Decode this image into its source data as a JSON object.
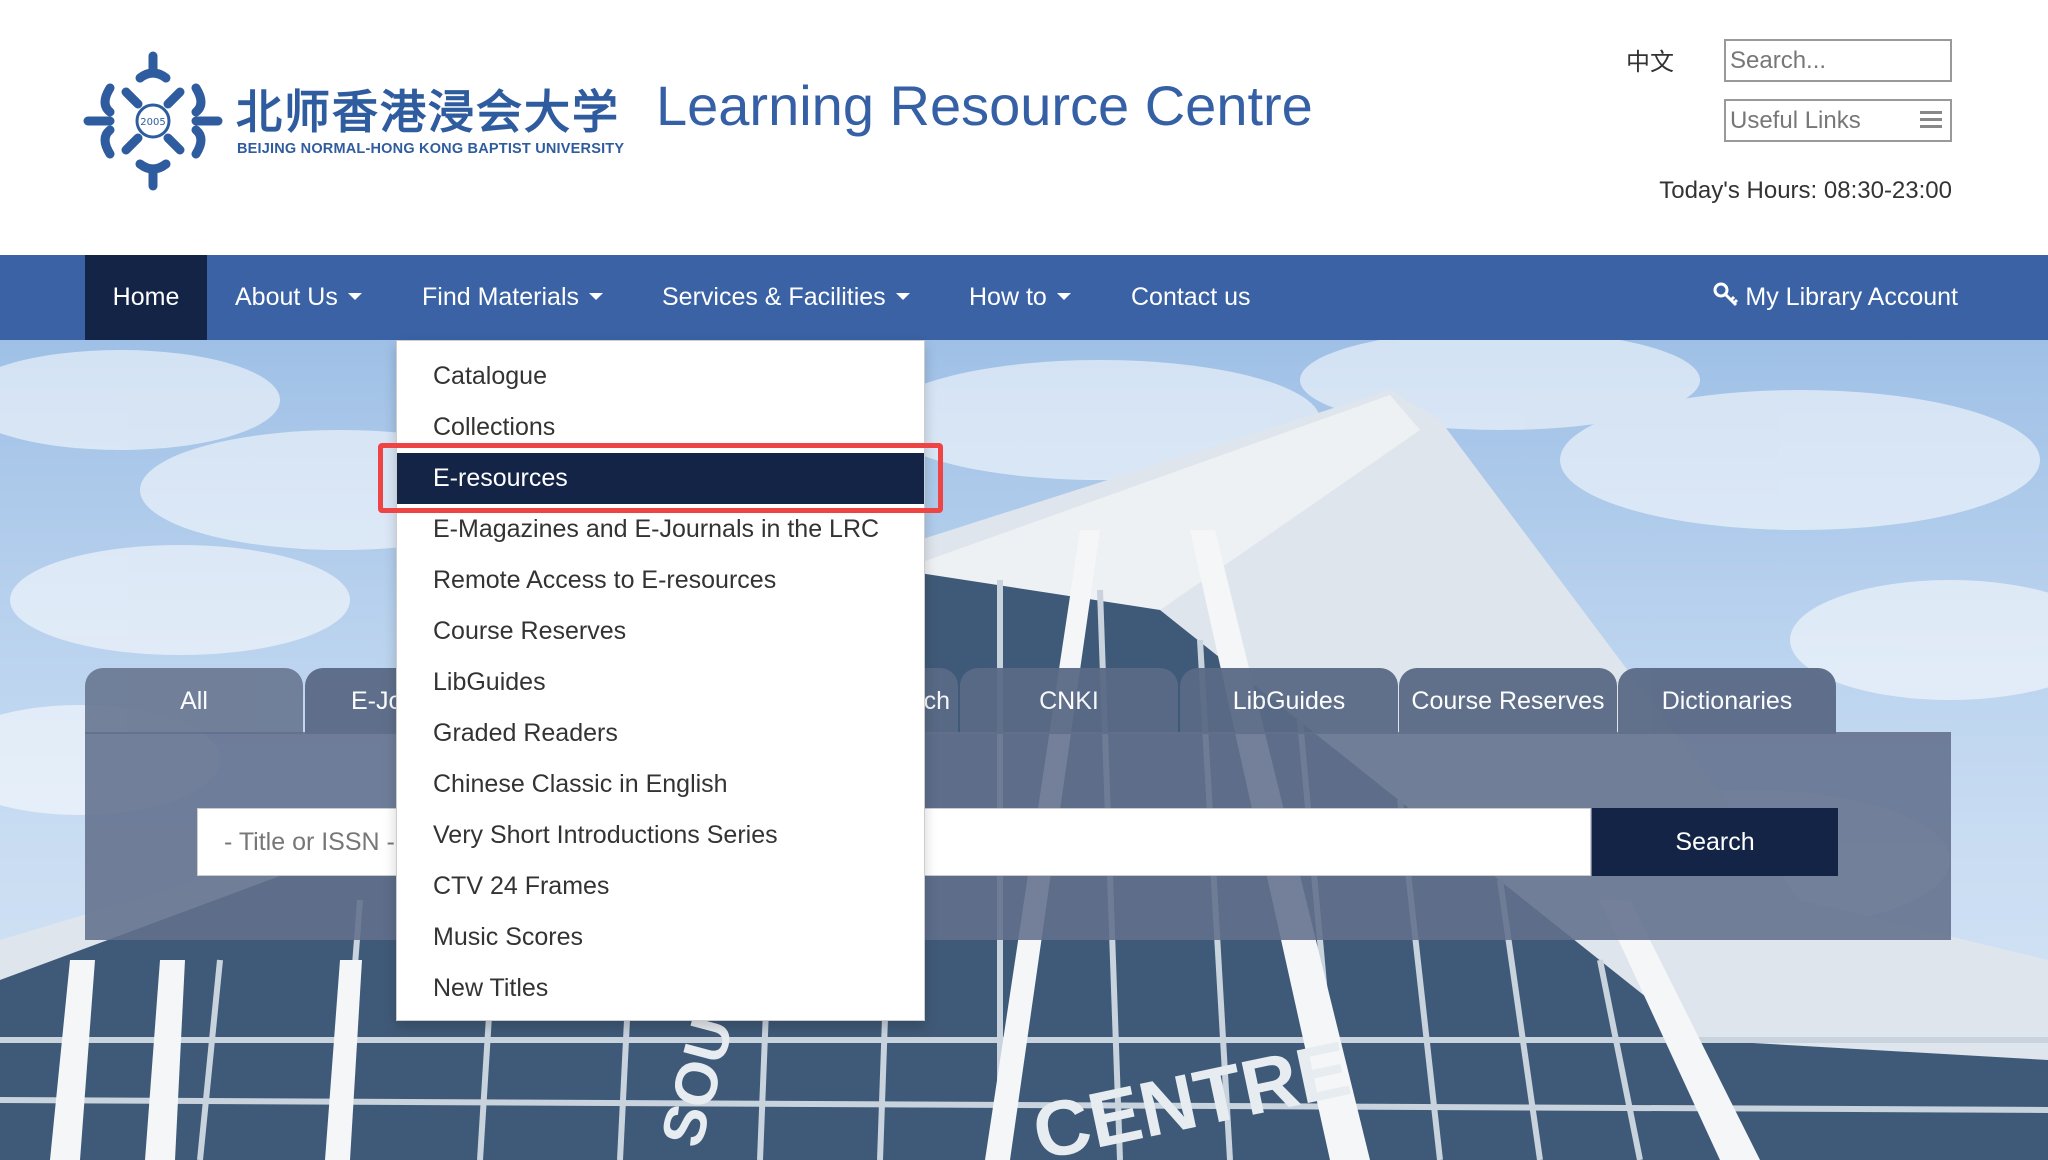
{
  "header": {
    "logo_year": "2005",
    "logo_cn": "北师香港浸会大学",
    "logo_en": "BEIJING NORMAL-HONG KONG BAPTIST UNIVERSITY",
    "site_title": "Learning Resource Centre",
    "lang_link": "中文",
    "search_placeholder": "Search...",
    "useful_links": "Useful Links",
    "hours": "Today's Hours: 08:30-23:00"
  },
  "nav": {
    "home": "Home",
    "about": "About Us",
    "find": "Find Materials",
    "services": "Services & Facilities",
    "howto": "How to",
    "contact": "Contact us",
    "account": "My Library Account"
  },
  "dropdown": {
    "items": [
      "Catalogue",
      "Collections",
      "E-resources",
      "E-Magazines and E-Journals in the LRC",
      "Remote Access to E-resources",
      "Course Reserves",
      "LibGuides",
      "Graded Readers",
      "Chinese Classic in English",
      "Very Short Introductions Series",
      "CTV 24 Frames",
      "Music Scores",
      "New Titles"
    ],
    "active_index": 2
  },
  "search": {
    "tabs": [
      "All",
      "E-Jo",
      "ch",
      "CNKI",
      "LibGuides",
      "Course Reserves",
      "Dictionaries"
    ],
    "input_placeholder": "- Title or ISSN -",
    "button": "Search"
  },
  "hero": {
    "building_text": [
      "SOUR",
      "CENTRE"
    ]
  },
  "colors": {
    "brand_blue": "#3a62a5",
    "nav_active": "#142447",
    "highlight": "#ef4444"
  }
}
